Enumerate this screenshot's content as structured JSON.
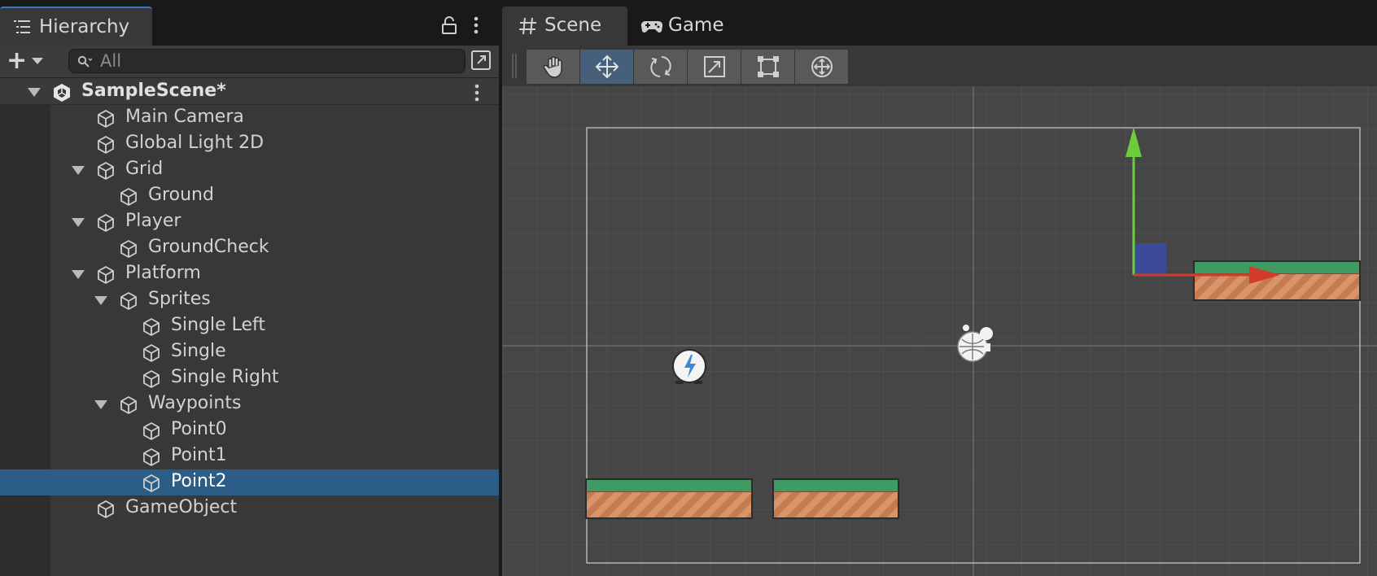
{
  "hierarchy": {
    "tab_label": "Hierarchy",
    "search": {
      "placeholder": "All",
      "value": ""
    },
    "rows": [
      {
        "label": "SampleScene*",
        "depth": 0,
        "foldable": true,
        "kind": "scene",
        "selected": false
      },
      {
        "label": "Main Camera",
        "depth": 1,
        "foldable": false,
        "kind": "object",
        "selected": false
      },
      {
        "label": "Global Light 2D",
        "depth": 1,
        "foldable": false,
        "kind": "object",
        "selected": false
      },
      {
        "label": "Grid",
        "depth": 1,
        "foldable": true,
        "kind": "object",
        "selected": false
      },
      {
        "label": "Ground",
        "depth": 2,
        "foldable": false,
        "kind": "object",
        "selected": false
      },
      {
        "label": "Player",
        "depth": 1,
        "foldable": true,
        "kind": "object",
        "selected": false
      },
      {
        "label": "GroundCheck",
        "depth": 2,
        "foldable": false,
        "kind": "object",
        "selected": false
      },
      {
        "label": "Platform",
        "depth": 1,
        "foldable": true,
        "kind": "object",
        "selected": false
      },
      {
        "label": "Sprites",
        "depth": 2,
        "foldable": true,
        "kind": "object",
        "selected": false
      },
      {
        "label": "Single Left",
        "depth": 3,
        "foldable": false,
        "kind": "object",
        "selected": false
      },
      {
        "label": "Single",
        "depth": 3,
        "foldable": false,
        "kind": "object",
        "selected": false
      },
      {
        "label": "Single Right",
        "depth": 3,
        "foldable": false,
        "kind": "object",
        "selected": false
      },
      {
        "label": "Waypoints",
        "depth": 2,
        "foldable": true,
        "kind": "object",
        "selected": false
      },
      {
        "label": "Point0",
        "depth": 3,
        "foldable": false,
        "kind": "object",
        "selected": false
      },
      {
        "label": "Point1",
        "depth": 3,
        "foldable": false,
        "kind": "object",
        "selected": false
      },
      {
        "label": "Point2",
        "depth": 3,
        "foldable": false,
        "kind": "object",
        "selected": true
      },
      {
        "label": "GameObject",
        "depth": 1,
        "foldable": false,
        "kind": "object",
        "selected": false
      }
    ]
  },
  "scene_view": {
    "tabs": [
      {
        "label": "Scene",
        "icon": "grid-hash-icon",
        "active": true
      },
      {
        "label": "Game",
        "icon": "gamepad-icon",
        "active": false
      }
    ],
    "tools": [
      {
        "name": "hand-tool",
        "icon": "hand-icon",
        "active": false
      },
      {
        "name": "move-tool",
        "icon": "move-arrows-icon",
        "active": true
      },
      {
        "name": "rotate-tool",
        "icon": "rotate-icon",
        "active": false
      },
      {
        "name": "scale-tool",
        "icon": "scale-icon",
        "active": false
      },
      {
        "name": "rect-tool",
        "icon": "rect-transform-icon",
        "active": false
      },
      {
        "name": "transform-tool",
        "icon": "transform-icon",
        "active": false
      }
    ]
  },
  "colors": {
    "selection": "#2c5d87",
    "active_tool": "#46607c",
    "tab_accent": "#3d78c2",
    "gizmo_x": "#d23a2a",
    "gizmo_y": "#6ccc3c",
    "gizmo_plane": "#3a4aa8",
    "grass": "#3f9a63",
    "dirt": "#c57a4f"
  }
}
